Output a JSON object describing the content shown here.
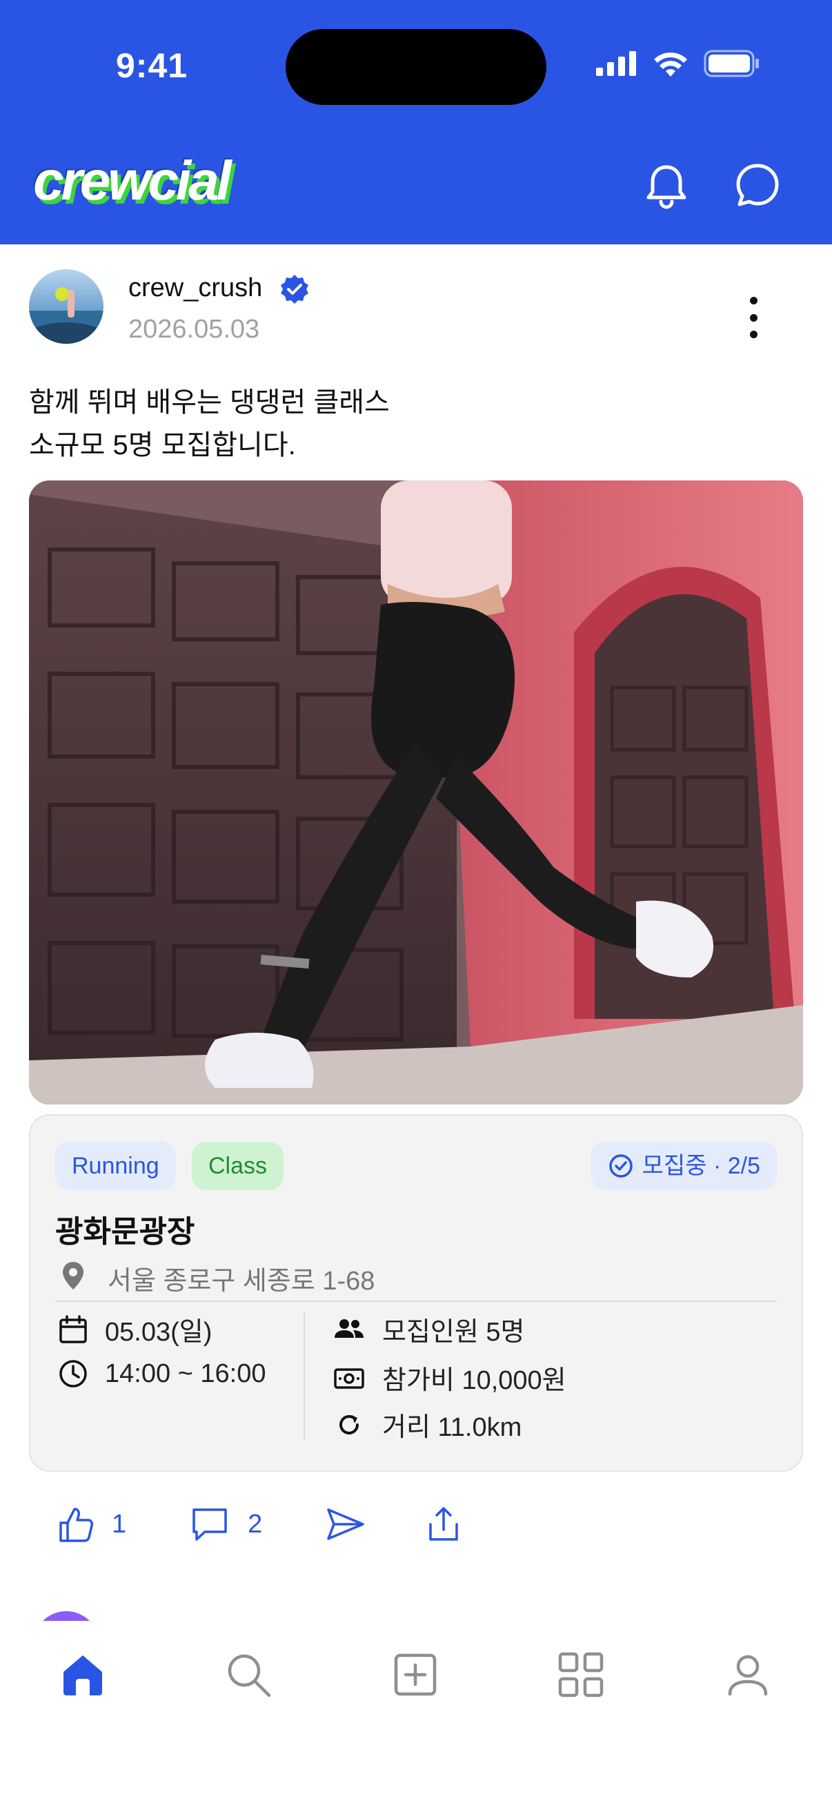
{
  "status_bar": {
    "time": "9:41"
  },
  "app": {
    "logo_text": "crewcial",
    "brand_color": "#2A55E4",
    "accent_green": "#3ED43E"
  },
  "header": {
    "icons": [
      "bell-icon",
      "chat-icon"
    ]
  },
  "post": {
    "username": "crew_crush",
    "verified": true,
    "date": "2026.05.03",
    "caption_line1": "함께 뛰며 배우는 댕댕런 클래스",
    "caption_line2": "소규모 5명 모집합니다.",
    "tags": {
      "running": "Running",
      "class": "Class"
    },
    "recruit_status": "모집중 · 2/5",
    "place_name": "광화문광장",
    "address": "서울 종로구 세종로 1-68",
    "date_label": "05.03(일)",
    "time_label": "14:00 ~ 16:00",
    "capacity": "모집인원 5명",
    "fee": "참가비 10,000원",
    "distance": "거리 11.0km",
    "likes": "1",
    "comments": "2"
  },
  "bottom_nav": {
    "items": [
      "home-icon",
      "search-icon",
      "add-icon",
      "grid-icon",
      "profile-icon"
    ],
    "active": "home"
  }
}
